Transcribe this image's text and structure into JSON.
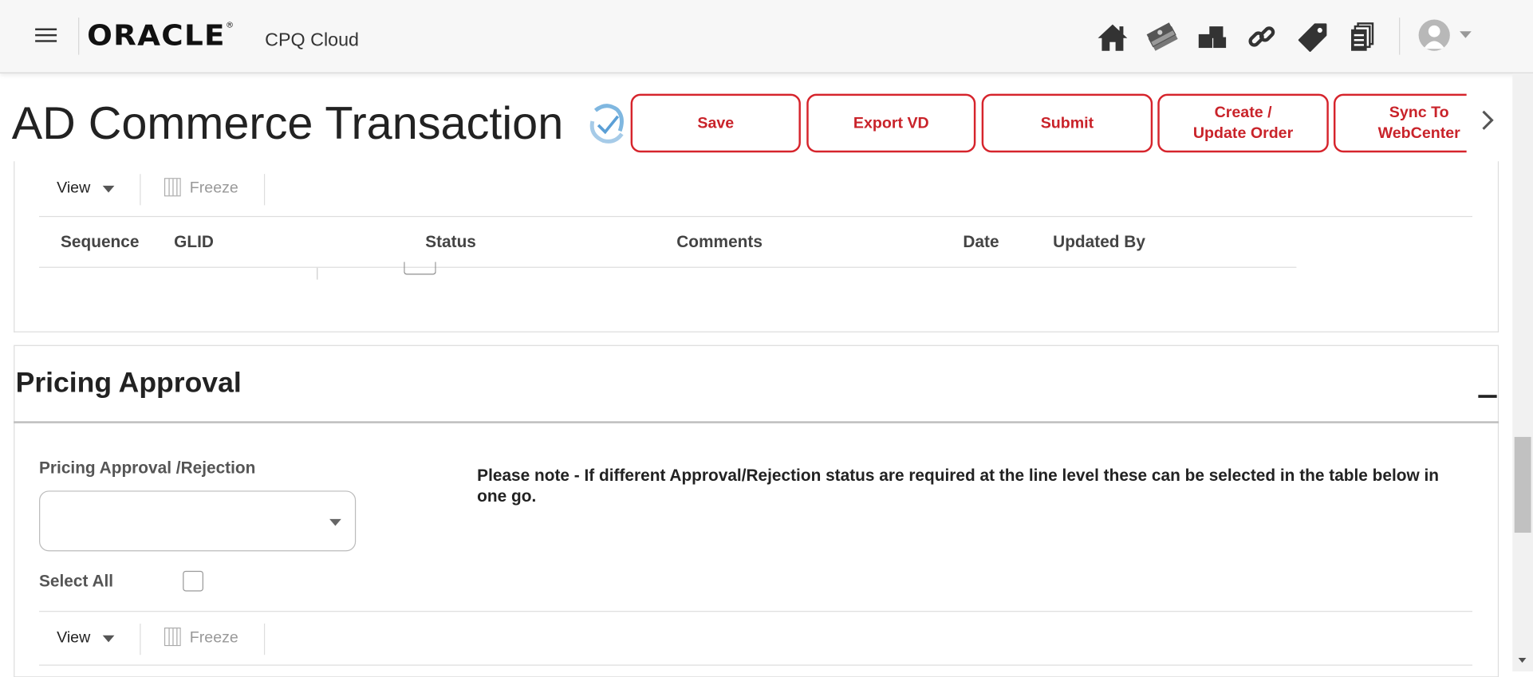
{
  "header": {
    "menu_icon": "hamburger-menu-icon",
    "logo_text": "ORACLE",
    "logo_mark": "®",
    "product": "CPQ Cloud",
    "icons": [
      "home-icon",
      "money-icon",
      "boxes-icon",
      "link-icon",
      "tag-icon",
      "documents-icon"
    ],
    "avatar_icon": "user-avatar-icon"
  },
  "title": {
    "text": "AD Commerce Transaction",
    "status_icon": "refresh-check-icon"
  },
  "actions": [
    {
      "label": "Save"
    },
    {
      "label": "Export VD"
    },
    {
      "label": "Submit"
    },
    {
      "label": "Create /\nUpdate Order"
    },
    {
      "label": "Sync To\nWebCenter"
    }
  ],
  "table1": {
    "view_label": "View",
    "freeze_label": "Freeze",
    "columns": [
      "Sequence",
      "GLID",
      "Status",
      "Comments",
      "Date",
      "Updated By"
    ]
  },
  "pricing": {
    "section_title": "Pricing Approval",
    "field_label": "Pricing Approval /Rejection",
    "select_value": "",
    "note": "Please note - If different Approval/Rejection status are required at the line level these can be selected in the table below in one go.",
    "select_all_label": "Select All",
    "select_all_checked": false,
    "view_label": "View",
    "freeze_label": "Freeze"
  },
  "colors": {
    "accent": "#c9232a",
    "header_bg": "#f7f7f7"
  }
}
